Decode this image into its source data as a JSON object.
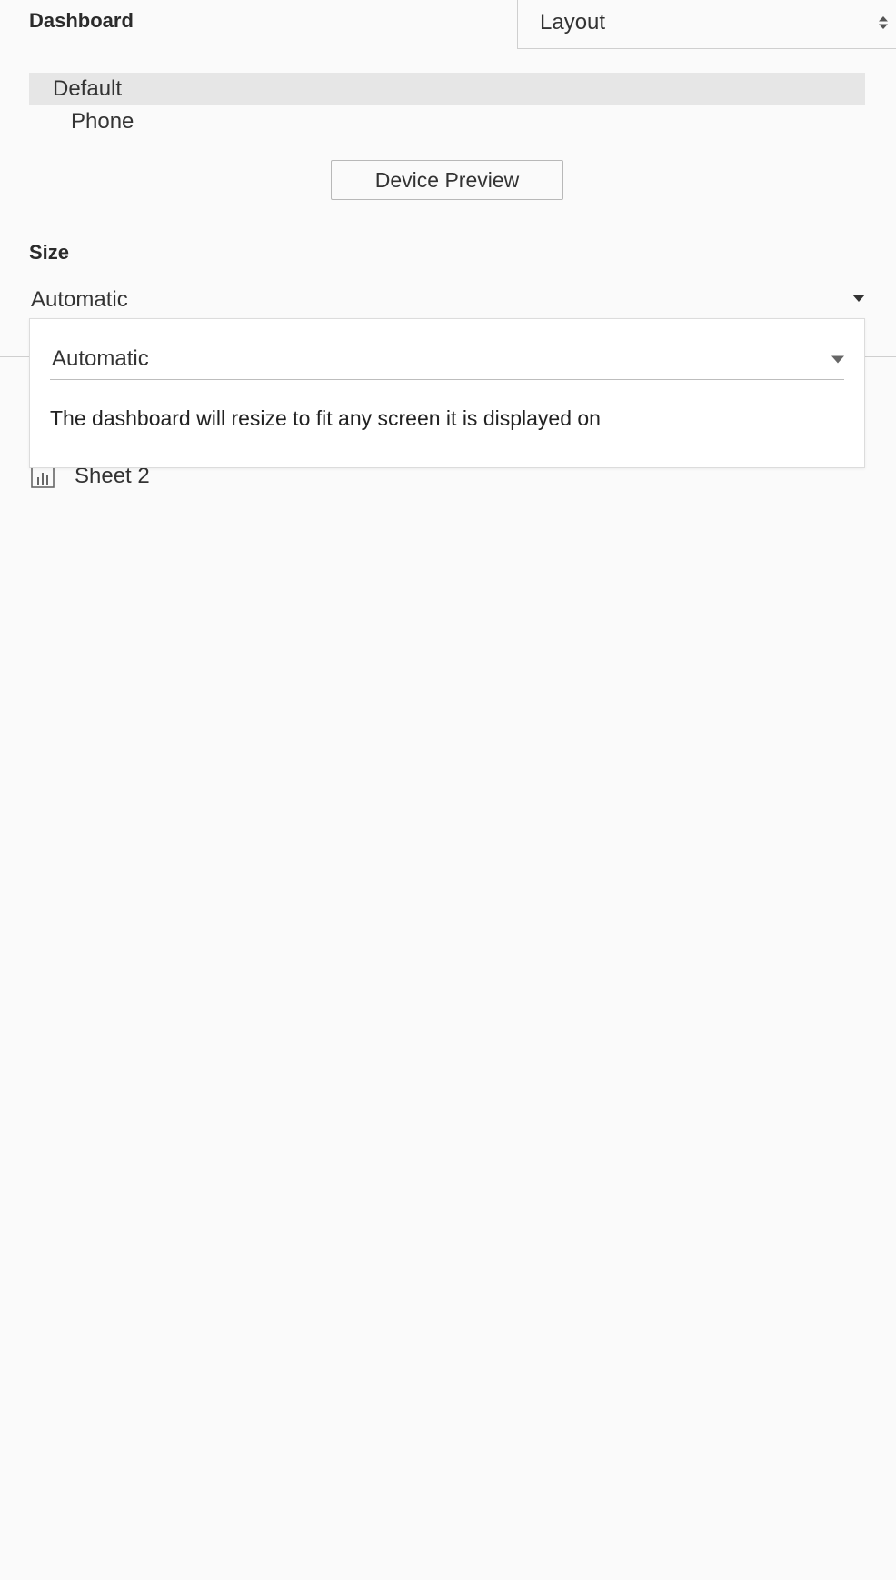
{
  "header": {
    "title": "Dashboard",
    "layout_select": "Layout"
  },
  "devices": {
    "items": [
      {
        "label": "Default",
        "selected": true
      },
      {
        "label": "Phone",
        "selected": false
      }
    ],
    "preview_button": "Device Preview"
  },
  "size": {
    "title": "Size",
    "selected": "Automatic",
    "popup": {
      "selected": "Automatic",
      "description": "The dashboard will resize to fit any screen it is displayed on"
    }
  },
  "sheets": {
    "items": [
      {
        "label": "Sheet 2",
        "icon": "bar-chart-icon"
      }
    ]
  },
  "colors": {
    "background": "#fafafa",
    "selected_row": "#e6e6e6",
    "divider": "#cfcfcf",
    "popup_bg": "#ffffff"
  }
}
